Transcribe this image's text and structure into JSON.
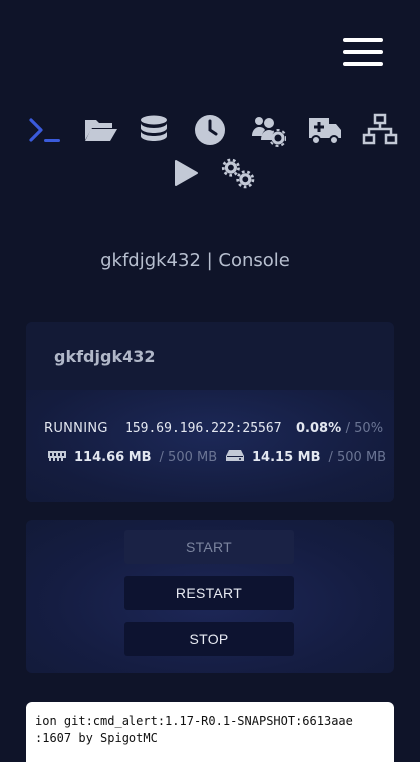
{
  "nav": {
    "menu_icon": "hamburger-menu-icon",
    "icons": [
      "terminal-icon",
      "folder-open-icon",
      "database-icon",
      "clock-icon",
      "users-gear-icon",
      "ambulance-icon",
      "network-icon",
      "play-icon",
      "gears-icon"
    ],
    "accent": "#3b5bdb",
    "icon_color": "#c3c9d6"
  },
  "page": {
    "title": "gkfdjgk432 | Console"
  },
  "server": {
    "name": "gkfdjgk432",
    "status": "RUNNING",
    "address": "159.69.196.222:25567",
    "cpu": "0.08%",
    "cpu_limit": "/ 50%",
    "memory": "114.66 MB",
    "memory_limit": "/ 500 MB",
    "disk": "14.15 MB",
    "disk_limit": "/ 500 MB"
  },
  "controls": {
    "start": "START",
    "restart": "RESTART",
    "stop": "STOP"
  },
  "console": {
    "lines": [
      "ion git:cmd_alert:1.17-R0.1-SNAPSHOT:6613aae",
      ":1607 by SpigotMC"
    ]
  }
}
